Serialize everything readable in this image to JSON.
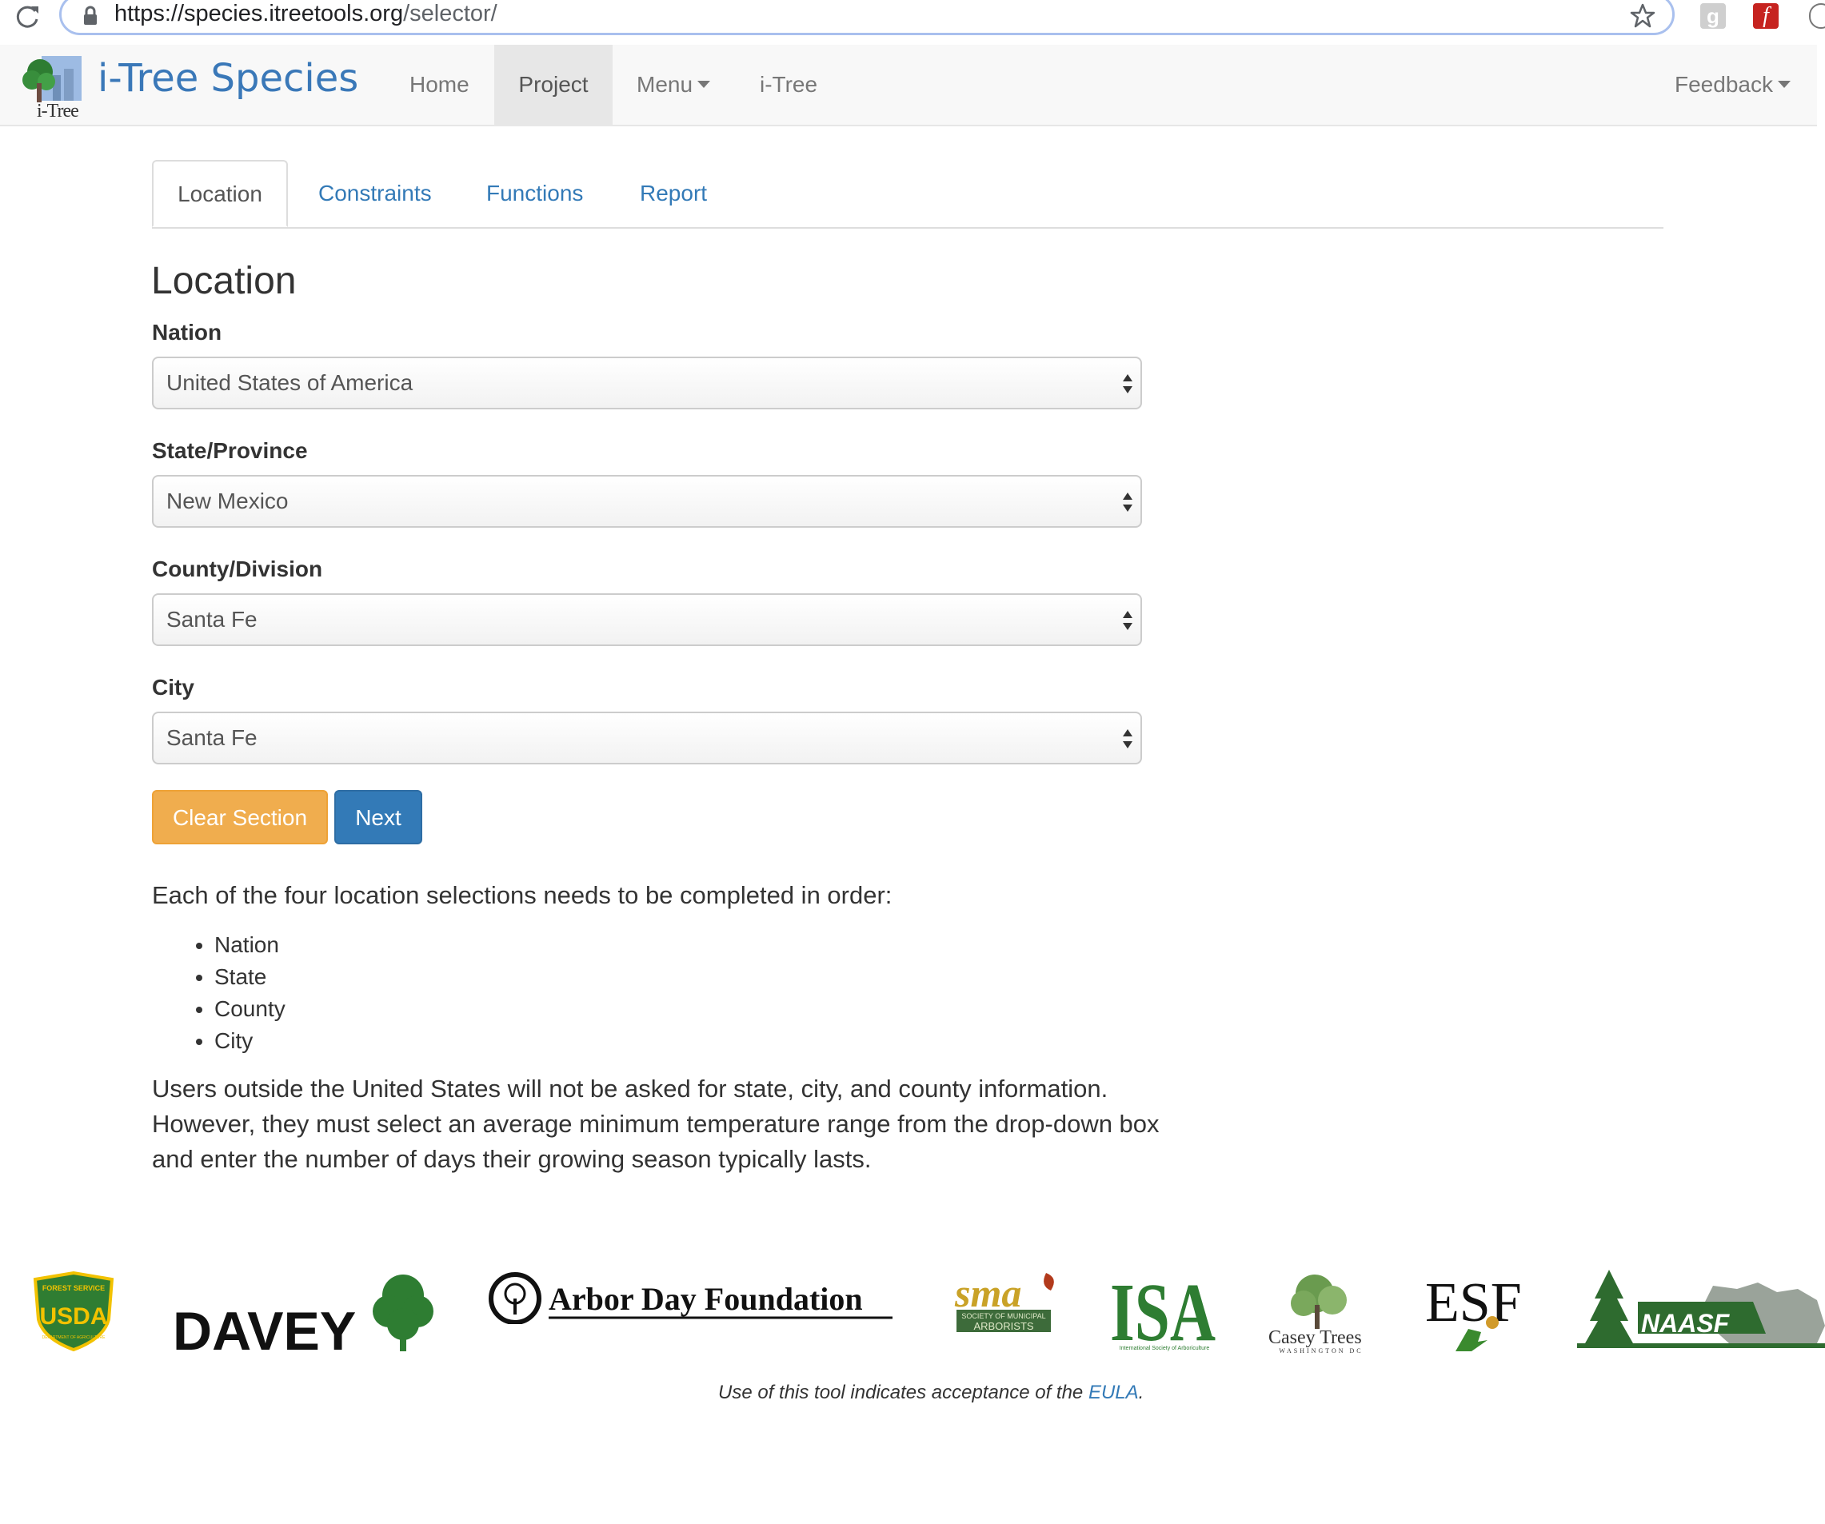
{
  "browser": {
    "url_host": "https://species.itreetools.org",
    "url_path": "/selector/"
  },
  "navbar": {
    "brand_logo_text": "i-Tree",
    "brand_name": "i-Tree Species",
    "items": [
      {
        "label": "Home"
      },
      {
        "label": "Project",
        "active": true
      },
      {
        "label": "Menu"
      },
      {
        "label": "i-Tree"
      }
    ],
    "feedback_label": "Feedback"
  },
  "tabs": [
    {
      "label": "Location",
      "active": true
    },
    {
      "label": "Constraints"
    },
    {
      "label": "Functions"
    },
    {
      "label": "Report"
    }
  ],
  "form": {
    "title": "Location",
    "fields": [
      {
        "label": "Nation",
        "value": "United States of America"
      },
      {
        "label": "State/Province",
        "value": "New Mexico"
      },
      {
        "label": "County/Division",
        "value": "Santa Fe"
      },
      {
        "label": "City",
        "value": "Santa Fe"
      }
    ],
    "clear_label": "Clear Section",
    "next_label": "Next"
  },
  "help": {
    "intro": "Each of the four location selections needs to be completed in order:",
    "steps": [
      "Nation",
      "State",
      "County",
      "City"
    ],
    "paragraph": "Users outside the United States will not be asked for state, city, and county information. However, they must select an average minimum temperature range from the drop-down box and enter the number of days their growing season typically lasts."
  },
  "footer": {
    "logos": {
      "forest_service_top": "FOREST SERVICE",
      "forest_service_bottom": "DEPARTMENT OF AGRICULTURE",
      "forest_service_mark": "USDA",
      "davey": "DAVEY",
      "arbor_day": "Arbor Day Foundation",
      "sma": "sma",
      "sma_sub1": "SOCIETY OF MUNICIPAL",
      "sma_sub2": "ARBORISTS",
      "isa": "ISA",
      "isa_sub": "International Society of Arboriculture",
      "casey": "Casey Trees",
      "casey_sub": "WASHINGTON DC",
      "esf": "ESF",
      "naasf": "NAASF"
    },
    "eula_prefix": "Use of this tool indicates acceptance of the ",
    "eula_link": "EULA",
    "eula_suffix": "."
  },
  "colors": {
    "link": "#337ab7",
    "brand": "#3a78b8",
    "clear_button": "#f0ad4e",
    "next_button": "#337ab7",
    "navbar_bg": "#f8f8f8"
  }
}
